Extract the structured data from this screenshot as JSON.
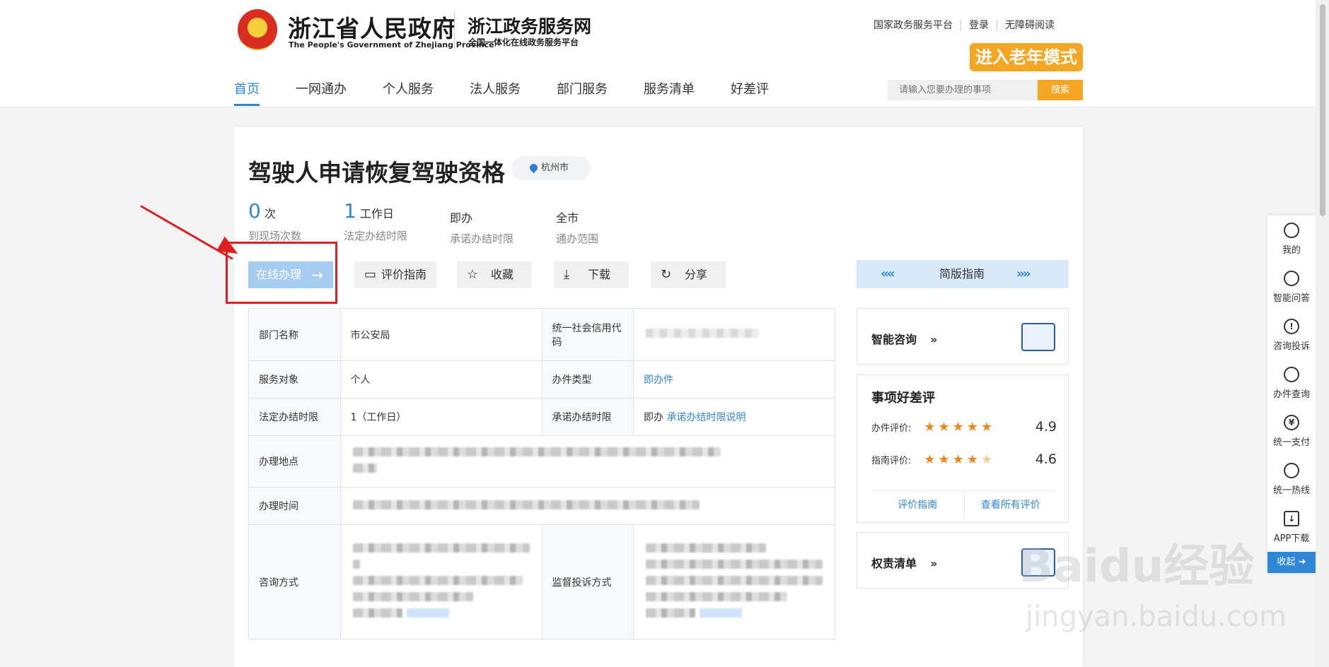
{
  "header": {
    "gov_name": "浙江省人民政府",
    "gov_name_en": "The People's Government of Zhejiang Province",
    "portal_name": "浙江政务服务网",
    "portal_sub": "全国一体化在线政务服务平台",
    "top_links": [
      "国家政务服务平台",
      "登录",
      "无障碍阅读"
    ],
    "elder_mode": "进入老年模式",
    "nav": [
      "首页",
      "一网通办",
      "个人服务",
      "法人服务",
      "部门服务",
      "服务清单",
      "好差评"
    ],
    "search_placeholder": "请输入您要办理的事项",
    "search_button": "搜索"
  },
  "item": {
    "title": "驾驶人申请恢复驾驶资格",
    "location": "杭州市",
    "stats": [
      {
        "value": "0",
        "unit": "次",
        "label": "到现场次数"
      },
      {
        "value": "1",
        "unit": "工作日",
        "label": "法定办结时限"
      },
      {
        "value": "即办",
        "label": "承诺办结时限"
      },
      {
        "value": "全市",
        "label": "通办范围"
      }
    ]
  },
  "actions": {
    "online": "在线办理",
    "evaluate_guide": "评价指南",
    "favorite": "收藏",
    "download": "下载",
    "share": "分享",
    "simple_guide": "简版指南"
  },
  "table": {
    "dept_label": "部门名称",
    "dept_value": "市公安局",
    "credit_label": "统一社会信用代码",
    "target_label": "服务对象",
    "target_value": "个人",
    "type_label": "办件类型",
    "type_value": "即办件",
    "legal_label": "法定办结时限",
    "legal_value": "1（工作日）",
    "promise_label": "承诺办结时限",
    "promise_value": "即办",
    "promise_link": "承诺办结时限说明",
    "place_label": "办理地点",
    "time_label": "办理时间",
    "consult_label": "咨询方式",
    "supervise_label": "监督投诉方式"
  },
  "right_panel": {
    "smart_consult": "智能咨询",
    "rating_title": "事项好差评",
    "rating_rows": [
      {
        "label": "办件评价:",
        "value": "4.9",
        "stars": 5
      },
      {
        "label": "指南评价:",
        "value": "4.6",
        "stars": 4.5
      }
    ],
    "eval_guide_link": "评价指南",
    "all_reviews_link": "查看所有评价",
    "power_list": "权责清单"
  },
  "sidebar": {
    "items": [
      "我的",
      "智能问答",
      "咨询投诉",
      "办件查询",
      "统一支付",
      "统一热线",
      "APP下载"
    ],
    "collapse": "收起"
  },
  "watermark": {
    "logo": "Baidu经验",
    "url": "jingyan.baidu.com"
  }
}
